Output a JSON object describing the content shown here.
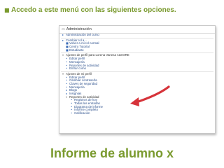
{
  "bullet": {
    "text": "Accedo a este menú con las siguientes opciones."
  },
  "screenshot": {
    "header": "Administración",
    "sections": [
      {
        "rows": [
          {
            "label": "Administración del curso",
            "indent": 0,
            "icon": "▸",
            "color": "blue"
          }
        ]
      },
      {
        "rows": [
          {
            "label": "Cambiar rol a...",
            "indent": 0,
            "icon": "▸",
            "color": "blue"
          },
          {
            "label": "Volver a mi rol normal",
            "indent": 1,
            "icon": "■",
            "color": "blue"
          },
          {
            "label": "Centro Tutorial",
            "indent": 1,
            "icon": "■",
            "color": "blue"
          },
          {
            "label": "Estudiante",
            "indent": 1,
            "icon": "■",
            "color": "blue"
          }
        ]
      },
      {
        "rows": [
          {
            "label": "Ajustes de perfil para Lorena Vanesa ALEGRE",
            "indent": 0,
            "icon": "▾",
            "color": "black"
          },
          {
            "label": "Editar perfil",
            "indent": 1,
            "icon": "•",
            "color": "blue"
          },
          {
            "label": "Mensajería",
            "indent": 1,
            "icon": "•",
            "color": "blue"
          },
          {
            "label": "Reportes de actividad",
            "indent": 1,
            "icon": "•",
            "color": "blue"
          },
          {
            "label": "Entrar como",
            "indent": 1,
            "icon": "•",
            "color": "blue"
          }
        ]
      },
      {
        "rows": [
          {
            "label": "Ajustes de mi perfil",
            "indent": 0,
            "icon": "▾",
            "color": "black"
          },
          {
            "label": "Editar perfil",
            "indent": 1,
            "icon": "•",
            "color": "blue"
          },
          {
            "label": "Cambiar contraseña",
            "indent": 1,
            "icon": "•",
            "color": "blue"
          },
          {
            "label": "Claves de seguridad",
            "indent": 1,
            "icon": "•",
            "color": "blue"
          },
          {
            "label": "Mensajería",
            "indent": 1,
            "icon": "•",
            "color": "blue"
          },
          {
            "label": "Blogs",
            "indent": 1,
            "icon": "▸",
            "color": "blue"
          },
          {
            "label": "Insignias",
            "indent": 1,
            "icon": "▸",
            "color": "blue"
          },
          {
            "label": "Reportes de actividad",
            "indent": 1,
            "icon": "▾",
            "color": "black"
          },
          {
            "label": "Registros de hoy",
            "indent": 2,
            "icon": "•",
            "color": "blue"
          },
          {
            "label": "Todas las entradas",
            "indent": 2,
            "icon": "•",
            "color": "blue"
          },
          {
            "label": "Diagrama de informe",
            "indent": 2,
            "icon": "•",
            "color": "blue"
          },
          {
            "label": "Informe completo",
            "indent": 2,
            "icon": "•",
            "color": "blue"
          },
          {
            "label": "Calificación",
            "indent": 2,
            "icon": "•",
            "color": "blue"
          }
        ]
      }
    ]
  },
  "title": "Informe de alumno x",
  "colors": {
    "accent": "#7a9a2e",
    "link": "#2b4f8c",
    "arrow": "#d6333a"
  }
}
